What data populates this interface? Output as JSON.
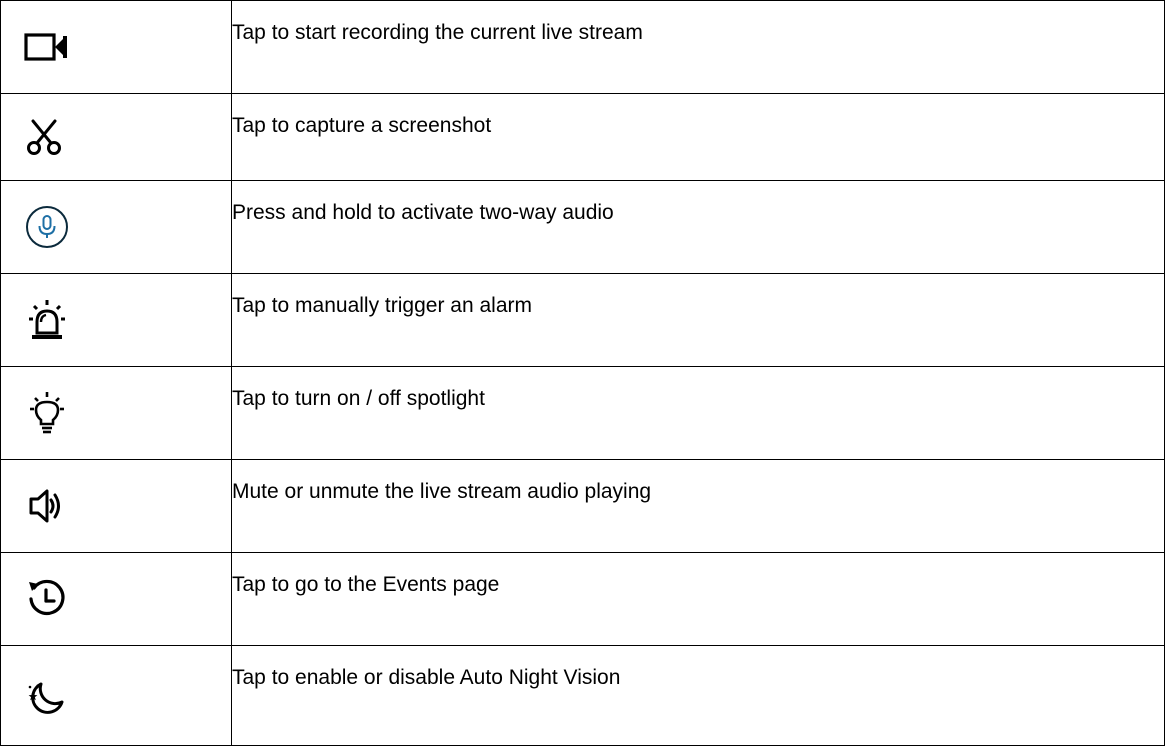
{
  "rows": [
    {
      "icon": "video-camera-icon",
      "text": "Tap to start recording the current live stream"
    },
    {
      "icon": "scissors-icon",
      "text": "Tap to capture a screenshot"
    },
    {
      "icon": "microphone-icon",
      "text": "Press and hold to activate two-way audio"
    },
    {
      "icon": "alarm-siren-icon",
      "text": "Tap to manually trigger an alarm"
    },
    {
      "icon": "lightbulb-icon",
      "text": "Tap to turn on / off spotlight"
    },
    {
      "icon": "speaker-icon",
      "text": "Mute or unmute the live stream audio playing"
    },
    {
      "icon": "history-clock-icon",
      "text": "Tap to go to the Events page"
    },
    {
      "icon": "night-moon-icon",
      "text": "Tap to enable or disable Auto Night Vision"
    }
  ],
  "colors": {
    "icon": "#000000",
    "mic_accent": "#1d6fa5",
    "border": "#000000"
  }
}
